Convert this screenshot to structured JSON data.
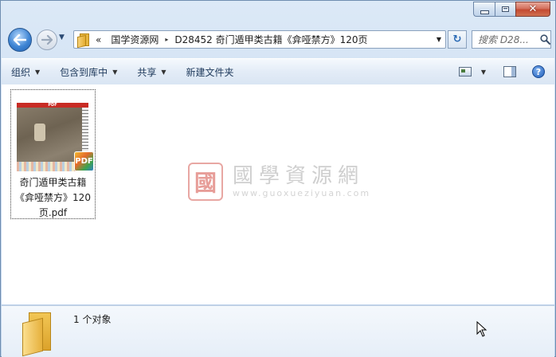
{
  "window": {
    "caption_buttons": {
      "close_glyph": "✕"
    }
  },
  "nav": {
    "history_arrow": "▼",
    "breadcrumb_overflow": "«",
    "crumbs": [
      "国学资源网",
      "D28452 奇门遁甲类古籍《弇哑禁方》120页"
    ],
    "crumb_separator": "▸",
    "address_dropdown": "▼",
    "refresh_glyph": "↻",
    "search_placeholder": "搜索 D28..."
  },
  "toolbar": {
    "items": [
      {
        "label": "组织",
        "dropdown": true
      },
      {
        "label": "包含到库中",
        "dropdown": true
      },
      {
        "label": "共享",
        "dropdown": true
      },
      {
        "label": "新建文件夹",
        "dropdown": false
      }
    ],
    "dropdown_glyph": "▼",
    "help_glyph": "?"
  },
  "files": [
    {
      "name": "奇门遁甲类古籍《弇哑禁方》120页.pdf",
      "type_badge": "PDF",
      "thumb_header": "PDF"
    }
  ],
  "watermark": {
    "seal_char": "國",
    "name": "國學資源網",
    "url": "www.guoxueziyuan.com"
  },
  "details": {
    "object_count": "1 个对象"
  },
  "icons": {
    "back": "back-arrow-icon",
    "forward": "forward-arrow-icon",
    "search": "search-icon",
    "folder": "folder-icon",
    "help": "help-icon",
    "pdf": "pdf-icon"
  },
  "colors": {
    "window_frame": "#c4d7ee",
    "toolbar_text": "#1e395b",
    "close_button": "#c44b32",
    "back_button": "#3f85d4"
  }
}
